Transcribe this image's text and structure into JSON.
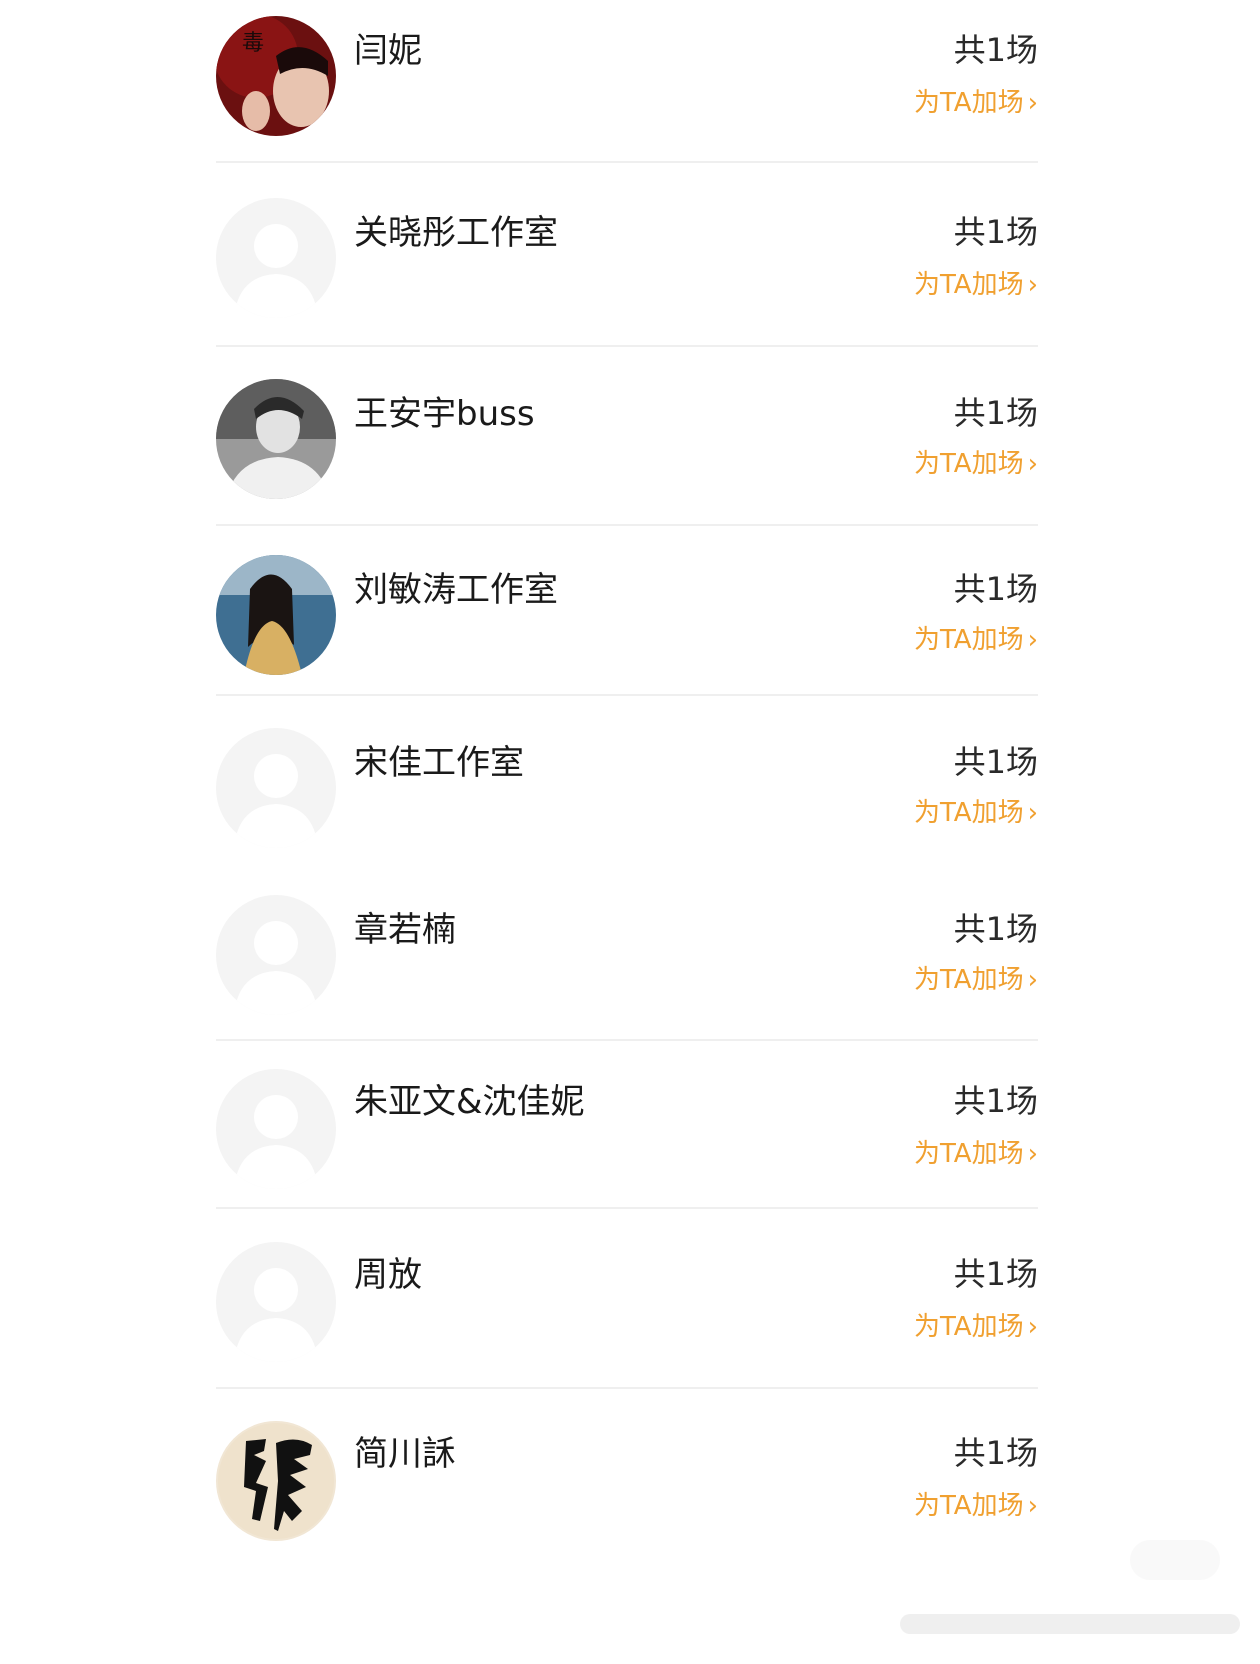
{
  "rows": [
    {
      "name": "闫妮",
      "count": "共1场",
      "action": "为TA加场",
      "avatar": "photo-red-portrait-icon"
    },
    {
      "name": "关晓彤工作室",
      "count": "共1场",
      "action": "为TA加场",
      "avatar": "default-avatar-icon"
    },
    {
      "name": "王安宇buss",
      "count": "共1场",
      "action": "为TA加场",
      "avatar": "photo-bw-portrait-icon"
    },
    {
      "name": "刘敏涛工作室",
      "count": "共1场",
      "action": "为TA加场",
      "avatar": "photo-sea-portrait-icon"
    },
    {
      "name": "宋佳工作室",
      "count": "共1场",
      "action": "为TA加场",
      "avatar": "default-avatar-icon"
    },
    {
      "name": "章若楠",
      "count": "共1场",
      "action": "为TA加场",
      "avatar": "default-avatar-icon"
    },
    {
      "name": "朱亚文&沈佳妮",
      "count": "共1场",
      "action": "为TA加场",
      "avatar": "default-avatar-icon"
    },
    {
      "name": "周放",
      "count": "共1场",
      "action": "为TA加场",
      "avatar": "default-avatar-icon"
    },
    {
      "name": "简川訸",
      "count": "共1场",
      "action": "为TA加场",
      "avatar": "calligraphy-avatar-icon"
    }
  ],
  "colors": {
    "accent": "#f0a030",
    "text": "#1a1a1a",
    "divider": "#efefef"
  }
}
